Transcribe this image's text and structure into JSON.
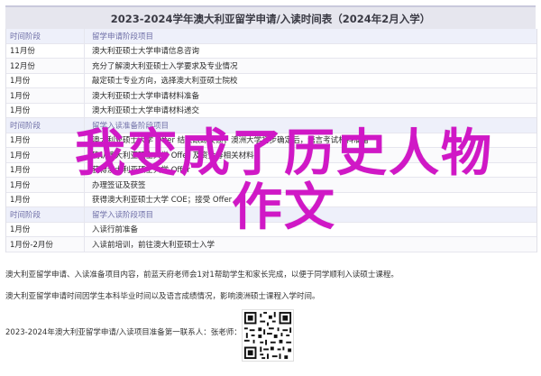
{
  "title": "2023-2024学年澳大利亚留学申请/入读时间表（2024年2月入学）",
  "table": {
    "rows": [
      {
        "time": "时间阶段",
        "item": "留学申请阶段项目",
        "head": true
      },
      {
        "time": "11月份",
        "item": "澳大利亚硕士大学申请信息咨询"
      },
      {
        "time": "12月份",
        "item": "充分了解澳大利亚硕士入学要求及专业情况"
      },
      {
        "time": "1月份",
        "item": "敲定硕士专业方向，选择澳大利亚硕士院校"
      },
      {
        "time": "1月份",
        "item": "澳大利亚硕士大学申请材料准备"
      },
      {
        "time": "1月份",
        "item": "澳大利亚硕士大学申请材料递交"
      },
      {
        "time": "时间阶段",
        "item": "留学入读准备阶段项目",
        "head": true
      },
      {
        "time": "1月份",
        "item": "澳大利亚硕士大学 Offer 结果跟踪反馈；澳洲大学初步确定后，语言考试材料准备"
      },
      {
        "time": "1月份",
        "item": "确认澳大利亚硕士大学 Offer 及资金等相关材料"
      },
      {
        "time": "1月份",
        "item": "获得澳大利亚硕士大学 Offer"
      },
      {
        "time": "1月份",
        "item": "办理签证及获签"
      },
      {
        "time": "1月份",
        "item": "获得澳大利亚硕士大学 COE；接受 Offer"
      },
      {
        "time": "时间阶段",
        "item": "留学入读阶段项目",
        "head": true
      },
      {
        "time": "1月份",
        "item": "入读行前准备"
      },
      {
        "time": "1月份-2月份",
        "item": "入读前培训，前往澳大利亚硕士入学"
      }
    ]
  },
  "overlay": {
    "line1": "我变成了历史人物",
    "line2": "作文"
  },
  "notes": {
    "n1": "澳大利亚留学申请、入读准备项目内容，前蓝天府老师会1对1帮助学生和家长完成，以便于同学顺利入读硕士课程。",
    "n2": "澳大利亚留学申请时间因学生本科毕业时间以及语言成绩情况，影响澳洲硕士课程入学时间。",
    "n3": "2023-2024年澳大利亚留学申请/入读项目准备第一联系人：张老师："
  },
  "colors": {
    "overlay": "#d018c6",
    "header_text": "#6f6fa7"
  }
}
